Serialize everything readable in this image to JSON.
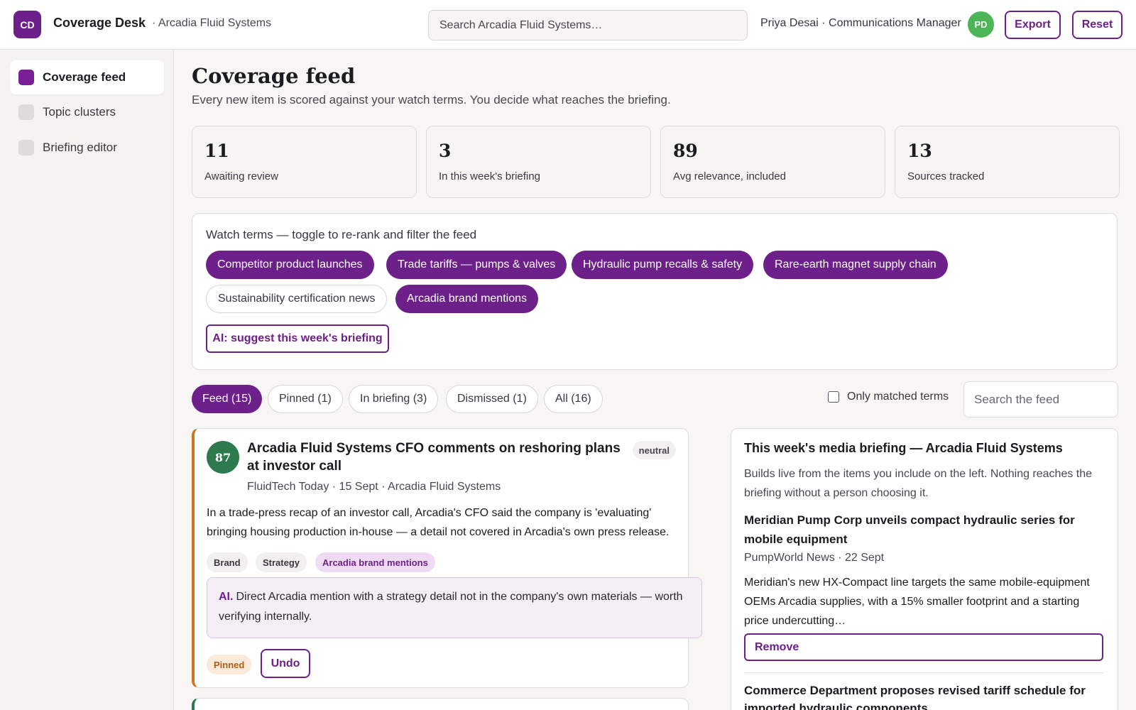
{
  "topbar": {
    "logo_initials": "CD",
    "app_title": "Coverage Desk",
    "org_label": "· Arcadia Fluid Systems",
    "search_placeholder": "Search Arcadia Fluid Systems…",
    "user_label": "Priya Desai · Communications Manager",
    "avatar_initials": "PD",
    "export_label": "Export",
    "reset_label": "Reset"
  },
  "sidebar": {
    "items": [
      {
        "label": "Coverage feed",
        "active": true
      },
      {
        "label": "Topic clusters",
        "active": false
      },
      {
        "label": "Briefing editor",
        "active": false
      }
    ]
  },
  "page": {
    "title": "Coverage feed",
    "description": "Every new item is scored against your watch terms. You decide what reaches the briefing."
  },
  "stats": [
    {
      "value": "11",
      "label": "Awaiting review"
    },
    {
      "value": "3",
      "label": "In this week's briefing"
    },
    {
      "value": "89",
      "label": "Avg relevance, included"
    },
    {
      "value": "13",
      "label": "Sources tracked"
    }
  ],
  "watch_terms": {
    "title": "Watch terms — toggle to re-rank and filter the feed",
    "terms": [
      {
        "label": "Competitor product launches",
        "on": true
      },
      {
        "label": "Trade tariffs — pumps & valves",
        "on": true
      },
      {
        "label": "Hydraulic pump recalls & safety",
        "on": true
      },
      {
        "label": "Rare-earth magnet supply chain",
        "on": true
      },
      {
        "label": "Sustainability certification news",
        "on": false
      },
      {
        "label": "Arcadia brand mentions",
        "on": true
      }
    ],
    "ai_button": "AI: suggest this week's briefing"
  },
  "tabs": [
    {
      "label": "Feed (15)",
      "active": true
    },
    {
      "label": "Pinned (1)",
      "active": false
    },
    {
      "label": "In briefing (3)",
      "active": false
    },
    {
      "label": "Dismissed (1)",
      "active": false
    },
    {
      "label": "All (16)",
      "active": false
    }
  ],
  "filters": {
    "only_matched_label": "Only matched terms",
    "only_matched_checked": false,
    "feed_search_placeholder": "Search the feed"
  },
  "feed_item": {
    "score": "87",
    "title": "Arcadia Fluid Systems CFO comments on reshoring plans at investor call",
    "sentiment": "neutral",
    "meta": "FluidTech Today · 15 Sept · Arcadia Fluid Systems",
    "body": "In a trade-press recap of an investor call, Arcadia's CFO said the company is 'evaluating' bringing housing production in-house — a detail not covered in Arcadia's own press release.",
    "tags": [
      "Brand",
      "Strategy",
      "Arcadia brand mentions"
    ],
    "ai_label": "AI.",
    "ai_note": "Direct Arcadia mention with a strategy detail not in the company's own materials — worth verifying internally.",
    "status_badge": "Pinned",
    "undo_label": "Undo"
  },
  "briefing": {
    "title": "This week's media briefing — Arcadia Fluid Systems",
    "description": "Builds live from the items you include on the left. Nothing reaches the briefing without a person choosing it.",
    "items": [
      {
        "title": "Meridian Pump Corp unveils compact hydraulic series for mobile equipment",
        "meta": "PumpWorld News · 22 Sept",
        "body": "Meridian's new HX-Compact line targets the same mobile-equipment OEMs Arcadia supplies, with a 15% smaller footprint and a starting price undercutting…",
        "remove_label": "Remove"
      },
      {
        "title": "Commerce Department proposes revised tariff schedule for imported hydraulic components"
      }
    ]
  },
  "colors": {
    "accent": "#6d1f8a",
    "score_high": "#2c7a4d",
    "pinned_border": "#c9781b",
    "avatar": "#4bb558"
  }
}
